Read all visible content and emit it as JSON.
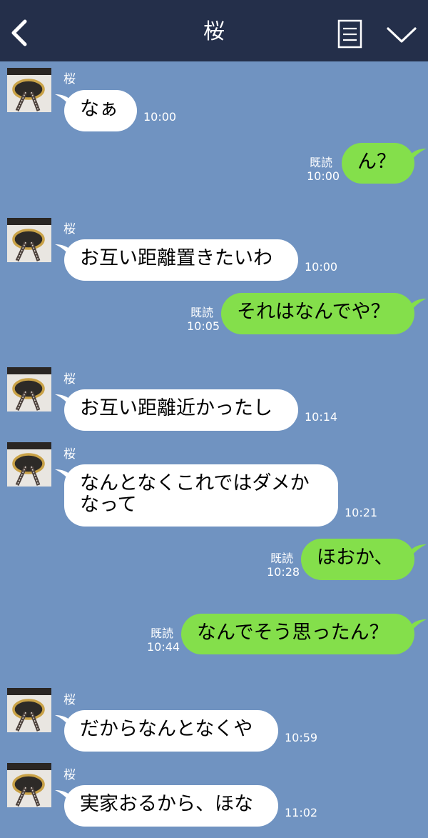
{
  "header": {
    "title": "桜",
    "colors": {
      "bar": "#242f4a",
      "background": "#7093c1",
      "out_bubble": "#84df4b"
    }
  },
  "messages": [
    {
      "sender": "桜",
      "text": "なぁ",
      "time": "10:00"
    },
    {
      "read": "既読",
      "text": "ん？",
      "time": "10:00"
    },
    {
      "sender": "桜",
      "text": "お互い距離置きたいわ",
      "time": "10:00"
    },
    {
      "read": "既読",
      "text": "それはなんでや？",
      "time": "10:05"
    },
    {
      "sender": "桜",
      "text": "お互い距離近かったし",
      "time": "10:14"
    },
    {
      "sender": "桜",
      "text": "なんとなくこれではダメか\nなって",
      "time": "10:21"
    },
    {
      "read": "既読",
      "text": "ほおか、",
      "time": "10:28"
    },
    {
      "read": "既読",
      "text": "なんでそう思ったん？",
      "time": "10:44"
    },
    {
      "sender": "桜",
      "text": "だからなんとなくや",
      "time": "10:59"
    },
    {
      "sender": "桜",
      "text": "実家おるから、ほな",
      "time": "11:02"
    }
  ]
}
